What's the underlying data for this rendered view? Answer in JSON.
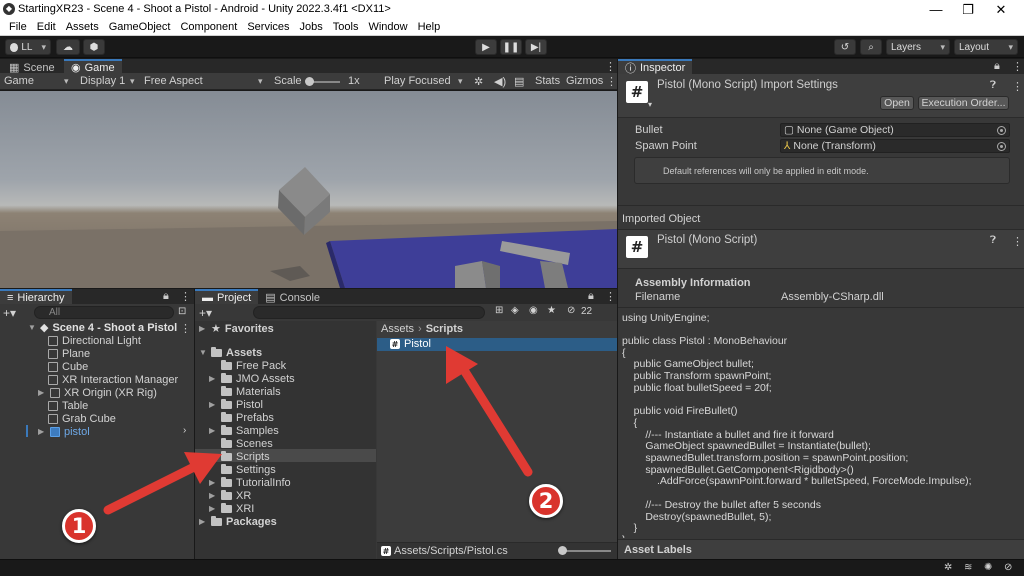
{
  "window": {
    "title": "StartingXR23 - Scene 4 - Shoot a Pistol - Android - Unity 2022.3.4f1 <DX11>",
    "minimize": "—",
    "maximize": "❐",
    "close": "✕"
  },
  "menu": [
    "File",
    "Edit",
    "Assets",
    "GameObject",
    "Component",
    "Services",
    "Jobs",
    "Tools",
    "Window",
    "Help"
  ],
  "toolbar": {
    "account": "LL",
    "layers": "Layers",
    "layout": "Layout"
  },
  "scene_tabs": {
    "scene": "Scene",
    "game": "Game"
  },
  "game_toolbar": {
    "mode": "Game",
    "display": "Display 1",
    "aspect": "Free Aspect",
    "scale_label": "Scale",
    "scale_value": "1x",
    "play_mode": "Play Focused",
    "stats": "Stats",
    "gizmos": "Gizmos"
  },
  "hierarchy": {
    "tab": "Hierarchy",
    "search_placeholder": "All",
    "scene": "Scene 4 - Shoot a Pistol",
    "items": [
      "Directional Light",
      "Plane",
      "Cube",
      "XR Interaction Manager",
      "XR Origin (XR Rig)",
      "Table",
      "Grab Cube",
      "pistol"
    ]
  },
  "project": {
    "tab": "Project",
    "console_tab": "Console",
    "hidden_count": "22",
    "favorites": "Favorites",
    "assets": "Assets",
    "folders": [
      "Free Pack",
      "JMO Assets",
      "Materials",
      "Pistol",
      "Prefabs",
      "Samples",
      "Scenes",
      "Scripts",
      "Settings",
      "TutorialInfo",
      "XR",
      "XRI"
    ],
    "packages": "Packages",
    "breadcrumb": [
      "Assets",
      "Scripts"
    ],
    "files": [
      "Pistol"
    ],
    "footer_path": "Assets/Scripts/Pistol.cs"
  },
  "inspector": {
    "tab": "Inspector",
    "header_title": "Pistol (Mono Script) Import Settings",
    "open_button": "Open",
    "execution_order_button": "Execution Order...",
    "fields": [
      {
        "label": "Bullet",
        "value": "None (Game Object)"
      },
      {
        "label": "Spawn Point",
        "value": "None (Transform)"
      }
    ],
    "help_note": "Default references will only be applied in edit mode.",
    "imported_object": "Imported Object",
    "script_title": "Pistol (Mono Script)",
    "assembly_info": "Assembly Information",
    "filename_label": "Filename",
    "filename_value": "Assembly-CSharp.dll",
    "code": [
      "using UnityEngine;",
      "",
      "public class Pistol : MonoBehaviour",
      "{",
      "    public GameObject bullet;",
      "    public Transform spawnPoint;",
      "    public float bulletSpeed = 20f;",
      "",
      "    public void FireBullet()",
      "    {",
      "        //--- Instantiate a bullet and fire it forward",
      "        GameObject spawnedBullet = Instantiate(bullet);",
      "        spawnedBullet.transform.position = spawnPoint.position;",
      "        spawnedBullet.GetComponent<Rigidbody>()",
      "            .AddForce(spawnPoint.forward * bulletSpeed, ForceMode.Impulse);",
      "",
      "        //--- Destroy the bullet after 5 seconds",
      "        Destroy(spawnedBullet, 5);",
      "    }",
      "}"
    ],
    "asset_labels": "Asset Labels"
  },
  "annotations": {
    "one": "1",
    "two": "2",
    "color": "#e03a33"
  },
  "colors": {
    "accent": "#3a79bb",
    "selection": "#2c5d87",
    "panel": "#383838"
  }
}
